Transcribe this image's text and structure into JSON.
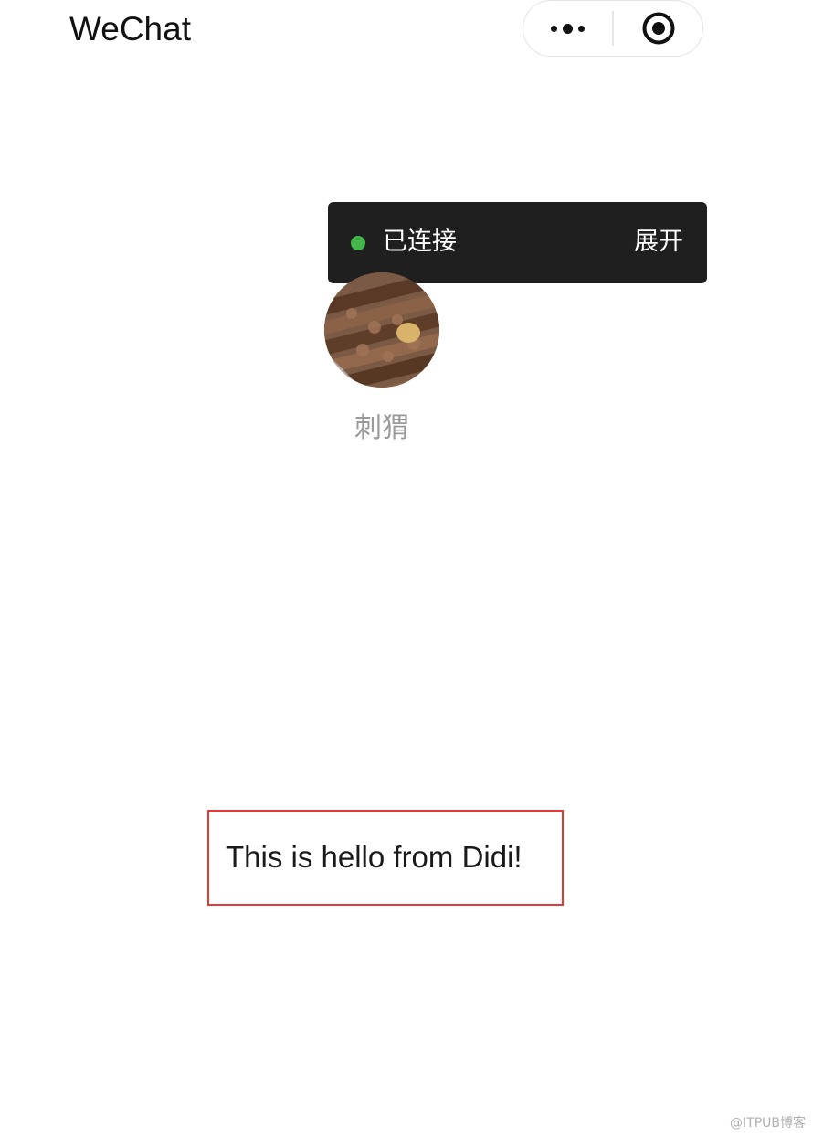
{
  "nav": {
    "title": "WeChat",
    "more_icon": "more-dots-icon",
    "close_icon": "target-circle-icon"
  },
  "connection": {
    "status": "已连接",
    "expand_label": "展开",
    "status_color": "#44b549",
    "banner_color": "#1f1f1f"
  },
  "profile": {
    "name": "刺猬",
    "avatar_icon": "avatar-food-photo"
  },
  "message": {
    "text": "This is hello from Didi!",
    "border_color": "#e53935"
  },
  "watermark": {
    "text": "@ITPUB博客"
  }
}
